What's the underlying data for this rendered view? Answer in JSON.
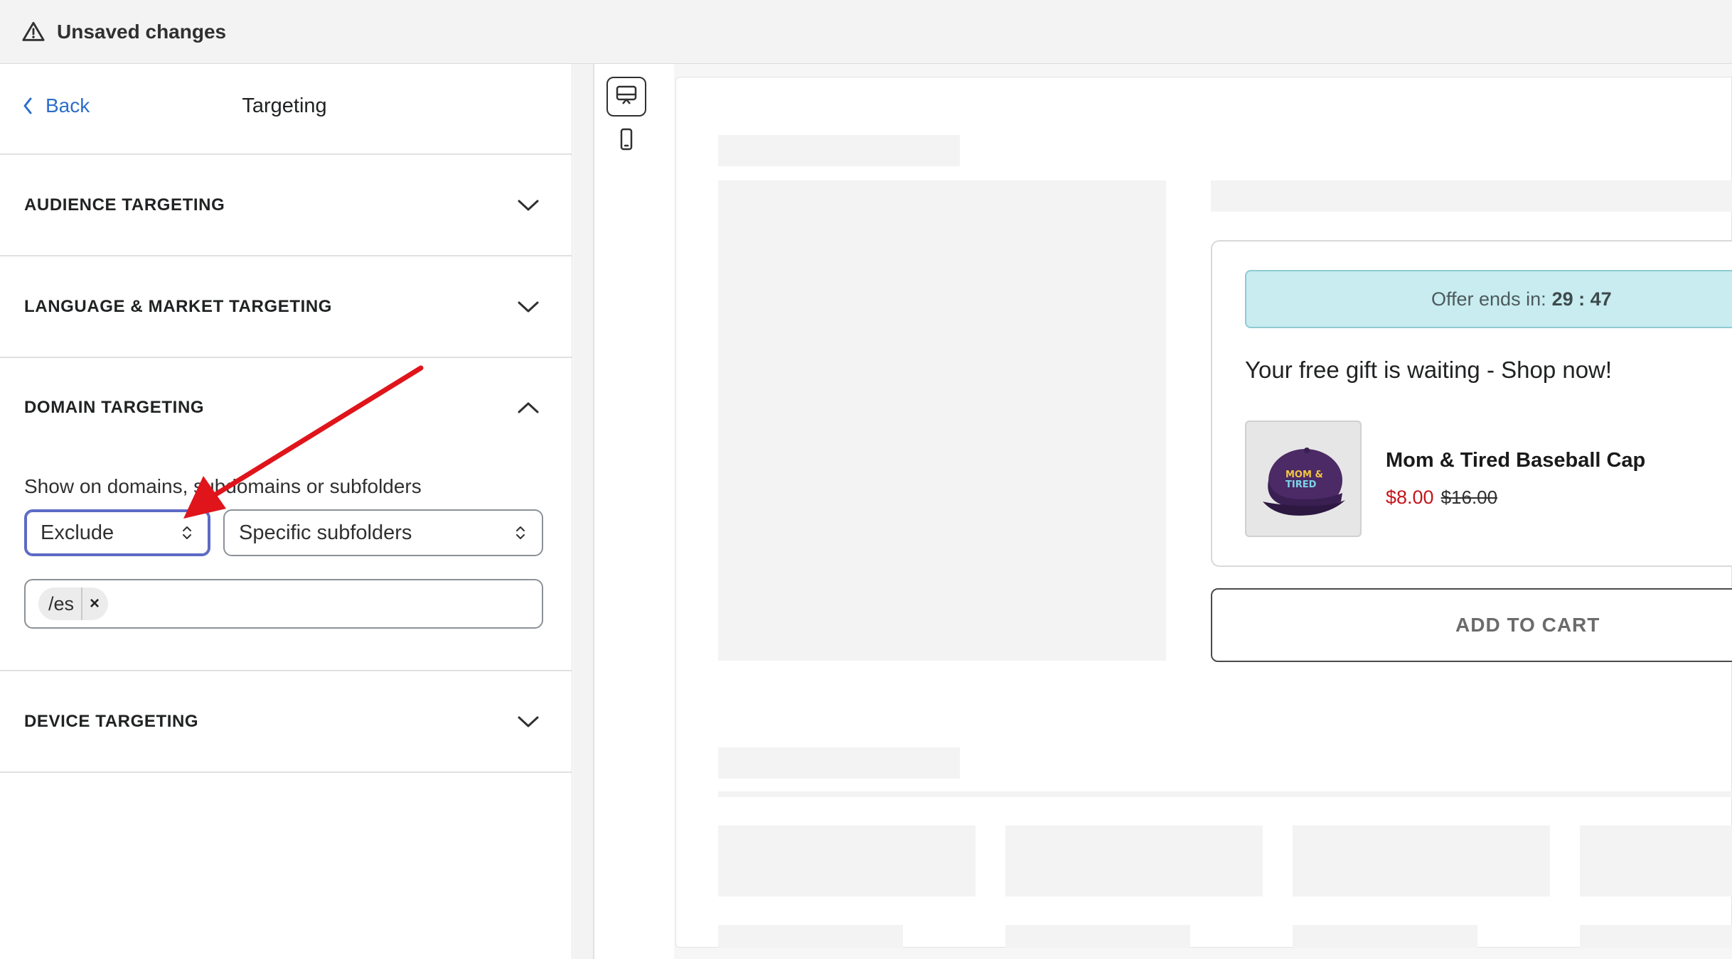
{
  "topbar": {
    "icon": "warning-icon",
    "title": "Unsaved changes"
  },
  "panel": {
    "back_label": "Back",
    "title": "Targeting"
  },
  "sections": {
    "audience": {
      "title": "AUDIENCE TARGETING",
      "expanded": false
    },
    "language": {
      "title": "LANGUAGE & MARKET TARGETING",
      "expanded": false
    },
    "domain": {
      "title": "DOMAIN TARGETING",
      "expanded": true,
      "field_label": "Show on domains, subdomains or subfolders",
      "mode_select": "Exclude",
      "scope_select": "Specific subfolders",
      "tags": [
        "/es"
      ],
      "tag_remove": "×"
    },
    "device": {
      "title": "DEVICE TARGETING",
      "expanded": false
    }
  },
  "device_toggle": {
    "options": [
      "desktop-icon",
      "mobile-icon"
    ],
    "selected": "desktop-icon"
  },
  "preview": {
    "timer_label": "Offer ends in:",
    "timer_value": "29 : 47",
    "gift_text": "Your free gift is waiting - Shop now!",
    "product_name": "Mom & Tired Baseball Cap",
    "price_sale": "$8.00",
    "price_original": "$16.00",
    "add_to_cart": "ADD TO CART",
    "cap_text": "MOM & TIRED"
  },
  "colors": {
    "link": "#2c6ecb",
    "focus_ring": "#5c6ac4",
    "timer_bg": "#c8ecf0",
    "sale_price": "#c4161c",
    "annotation_arrow": "#e0141b"
  }
}
